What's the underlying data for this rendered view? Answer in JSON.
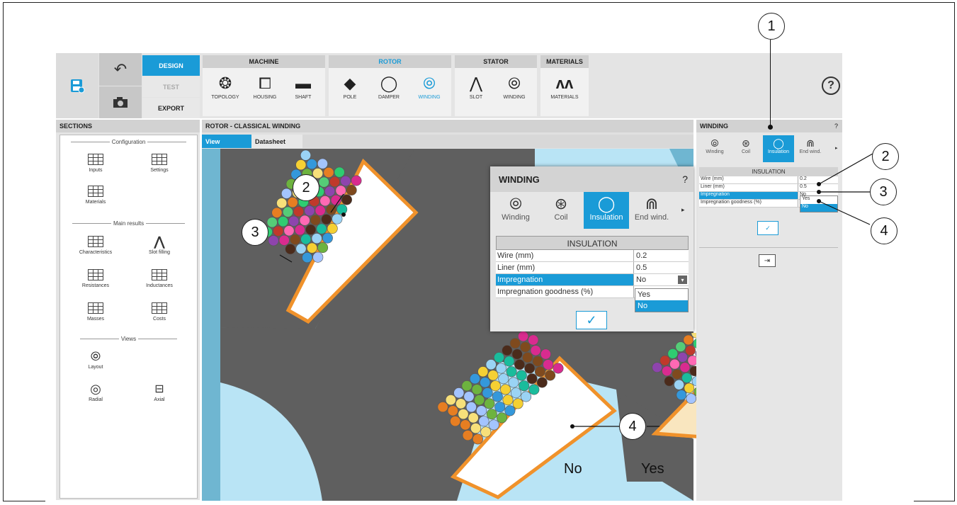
{
  "toolbar": {
    "modes": [
      "DESIGN",
      "TEST",
      "EXPORT"
    ],
    "groups": [
      {
        "title": "MACHINE",
        "tools": [
          {
            "label": "TOPOLOGY",
            "icon": "topology-icon"
          },
          {
            "label": "HOUSING",
            "icon": "housing-icon"
          },
          {
            "label": "SHAFT",
            "icon": "shaft-icon"
          }
        ]
      },
      {
        "title": "ROTOR",
        "tools": [
          {
            "label": "POLE",
            "icon": "pole-icon"
          },
          {
            "label": "DAMPER",
            "icon": "damper-icon"
          },
          {
            "label": "WINDING",
            "icon": "winding-icon"
          }
        ]
      },
      {
        "title": "STATOR",
        "tools": [
          {
            "label": "SLOT",
            "icon": "slot-icon"
          },
          {
            "label": "WINDING",
            "icon": "winding-icon"
          }
        ]
      },
      {
        "title": "MATERIALS",
        "tools": [
          {
            "label": "MATERIALS",
            "icon": "materials-icon"
          }
        ]
      }
    ],
    "help": "?"
  },
  "sections": {
    "title": "SECTIONS",
    "groups": [
      {
        "title": "Configuration",
        "items": [
          "Inputs",
          "Settings",
          "Materials"
        ]
      },
      {
        "title": "Main results",
        "items": [
          "Characteristics",
          "Slot filling",
          "Resistances",
          "Inductances",
          "Masses",
          "Costs"
        ]
      },
      {
        "title": "Views",
        "items": [
          "Layout",
          "Radial",
          "Axial"
        ]
      }
    ]
  },
  "center": {
    "title": "ROTOR - CLASSICAL WINDING",
    "tabs": [
      "View",
      "Datasheet"
    ],
    "labels": {
      "no": "No",
      "yes": "Yes"
    }
  },
  "winding_panel": {
    "title": "WINDING",
    "help": "?",
    "tabs": [
      "Winding",
      "Coil",
      "Insulation",
      "End wind."
    ],
    "table_title": "INSULATION",
    "rows": [
      {
        "key": "Wire (mm)",
        "value": "0.2"
      },
      {
        "key": "Liner (mm)",
        "value": "0.5"
      },
      {
        "key": "Impregnation",
        "value": "No"
      },
      {
        "key": "Impregnation goodness (%)",
        "value": ""
      }
    ],
    "options": [
      "Yes",
      "No"
    ]
  },
  "dialog": {
    "title": "WINDING",
    "help": "?",
    "tabs": [
      "Winding",
      "Coil",
      "Insulation",
      "End wind."
    ],
    "table_title": "INSULATION",
    "rows": [
      {
        "key": "Wire (mm)",
        "value": "0.2"
      },
      {
        "key": "Liner (mm)",
        "value": "0.5"
      },
      {
        "key": "Impregnation",
        "value": "No"
      },
      {
        "key": "Impregnation goodness (%)",
        "value": ""
      }
    ],
    "options": [
      "Yes",
      "No"
    ]
  },
  "callouts": [
    "1",
    "2",
    "3",
    "4",
    "2",
    "3",
    "4"
  ],
  "colors": {
    "accent": "#1a9bd7",
    "insulation_orange": "#f0922b",
    "iron_gray": "#5f5f5f",
    "air_blue": "#b9e4f5"
  }
}
